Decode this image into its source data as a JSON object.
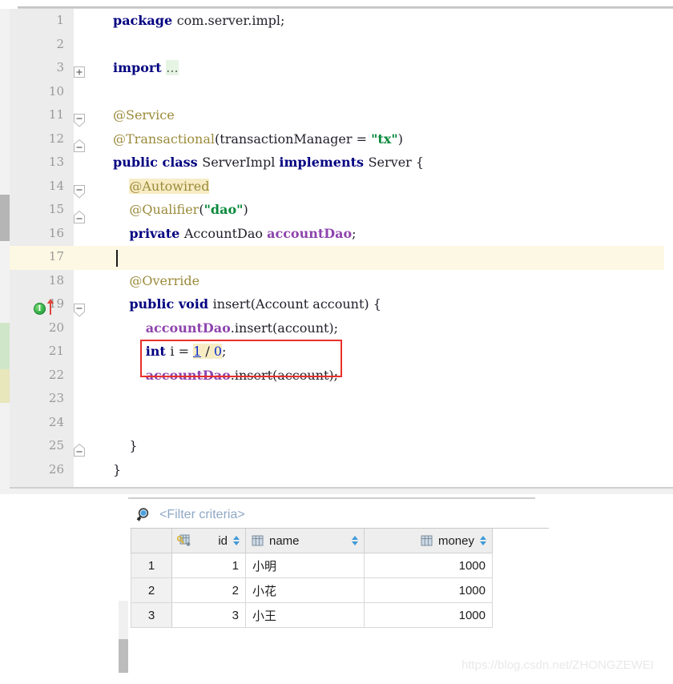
{
  "editor": {
    "top_line_number_start": 1,
    "lines": [
      {
        "num": "1",
        "segments": [
          {
            "t": "package ",
            "c": "kw"
          },
          {
            "t": "com.server.impl;",
            "c": "plain"
          }
        ]
      },
      {
        "num": "2",
        "segments": []
      },
      {
        "num": "3",
        "segments": [
          {
            "t": "import ",
            "c": "kw"
          },
          {
            "t": "...",
            "c": "dots hl-green"
          }
        ]
      },
      {
        "num": "10",
        "segments": []
      },
      {
        "num": "11",
        "segments": [
          {
            "t": "@Service",
            "c": "ann"
          }
        ]
      },
      {
        "num": "12",
        "segments": [
          {
            "t": "@Transactional",
            "c": "ann"
          },
          {
            "t": "(transactionManager = ",
            "c": "plain"
          },
          {
            "t": "\"tx\"",
            "c": "str"
          },
          {
            "t": ")",
            "c": "plain"
          }
        ]
      },
      {
        "num": "13",
        "segments": [
          {
            "t": "public class ",
            "c": "kw"
          },
          {
            "t": "ServerImpl ",
            "c": "plain"
          },
          {
            "t": "implements ",
            "c": "kw"
          },
          {
            "t": "Server {",
            "c": "plain"
          }
        ]
      },
      {
        "num": "14",
        "segments": [
          {
            "t": "    ",
            "c": "plain"
          },
          {
            "t": "@Autowired",
            "c": "ann hl-autowired"
          }
        ]
      },
      {
        "num": "15",
        "segments": [
          {
            "t": "    ",
            "c": "plain"
          },
          {
            "t": "@Qualifier",
            "c": "ann"
          },
          {
            "t": "(",
            "c": "plain"
          },
          {
            "t": "\"dao\"",
            "c": "str"
          },
          {
            "t": ")",
            "c": "plain"
          }
        ]
      },
      {
        "num": "16",
        "segments": [
          {
            "t": "    ",
            "c": "plain"
          },
          {
            "t": "private ",
            "c": "kw"
          },
          {
            "t": "AccountDao ",
            "c": "plain"
          },
          {
            "t": "accountDao",
            "c": "field"
          },
          {
            "t": ";",
            "c": "plain"
          }
        ]
      },
      {
        "num": "17",
        "segments": []
      },
      {
        "num": "18",
        "segments": [
          {
            "t": "    ",
            "c": "plain"
          },
          {
            "t": "@Override",
            "c": "ann"
          }
        ]
      },
      {
        "num": "19",
        "segments": [
          {
            "t": "    ",
            "c": "plain"
          },
          {
            "t": "public void ",
            "c": "kw"
          },
          {
            "t": "insert(Account account) {",
            "c": "plain"
          }
        ]
      },
      {
        "num": "20",
        "segments": [
          {
            "t": "        ",
            "c": "plain"
          },
          {
            "t": "accountDao",
            "c": "field"
          },
          {
            "t": ".insert(account);",
            "c": "plain"
          }
        ]
      },
      {
        "num": "21",
        "segments": [
          {
            "t": "        ",
            "c": "plain"
          },
          {
            "t": "int ",
            "c": "kw"
          },
          {
            "t": "i = ",
            "c": "plain"
          },
          {
            "t": "1",
            "c": "num num-underline hl-yellow"
          },
          {
            "t": " / ",
            "c": "plain hl-yellow"
          },
          {
            "t": "0",
            "c": "num hl-yellow"
          },
          {
            "t": ";",
            "c": "plain"
          }
        ]
      },
      {
        "num": "22",
        "segments": [
          {
            "t": "        ",
            "c": "plain"
          },
          {
            "t": "accountDao",
            "c": "field"
          },
          {
            "t": ".insert(account);",
            "c": "plain"
          }
        ]
      },
      {
        "num": "23",
        "segments": []
      },
      {
        "num": "24",
        "segments": []
      },
      {
        "num": "25",
        "segments": [
          {
            "t": "    }",
            "c": "plain"
          }
        ]
      },
      {
        "num": "26",
        "segments": [
          {
            "t": "}",
            "c": "plain"
          }
        ]
      }
    ],
    "gutter_icons": {
      "implemented_method_icon": "implemented-method-icon",
      "implemented_method_glyph": "I",
      "override_arrow_icon": "override-up-arrow-icon",
      "line": "19"
    },
    "annotation_box": {
      "label": "red-highlight-rectangle",
      "color": "#e8302b",
      "targets_line": "21"
    },
    "current_line": "17",
    "highlight_colors": {
      "current_line": "#fdf8e3",
      "search_match": "#f7ecc4",
      "folded_import": "#e6f4e4",
      "vcs_added": "#cfe6c8",
      "vcs_changed": "#e8e6bb"
    }
  },
  "result_table": {
    "filter": {
      "icon": "filter-search-icon",
      "placeholder": "<Filter criteria>",
      "value": ""
    },
    "row_number_header": "",
    "columns": [
      {
        "label": "id",
        "icon": "primary-key-column-icon",
        "sortable": true,
        "align": "right"
      },
      {
        "label": "name",
        "icon": "column-icon",
        "sortable": true,
        "align": "left"
      },
      {
        "label": "money",
        "icon": "column-icon",
        "sortable": true,
        "align": "right"
      }
    ],
    "rows": [
      {
        "n": "1",
        "id": "1",
        "name": "小明",
        "money": "1000"
      },
      {
        "n": "2",
        "id": "2",
        "name": "小花",
        "money": "1000"
      },
      {
        "n": "3",
        "id": "3",
        "name": "小王",
        "money": "1000"
      }
    ]
  },
  "watermark": {
    "text": "https://blog.csdn.net/ZHONGZEWEI"
  }
}
